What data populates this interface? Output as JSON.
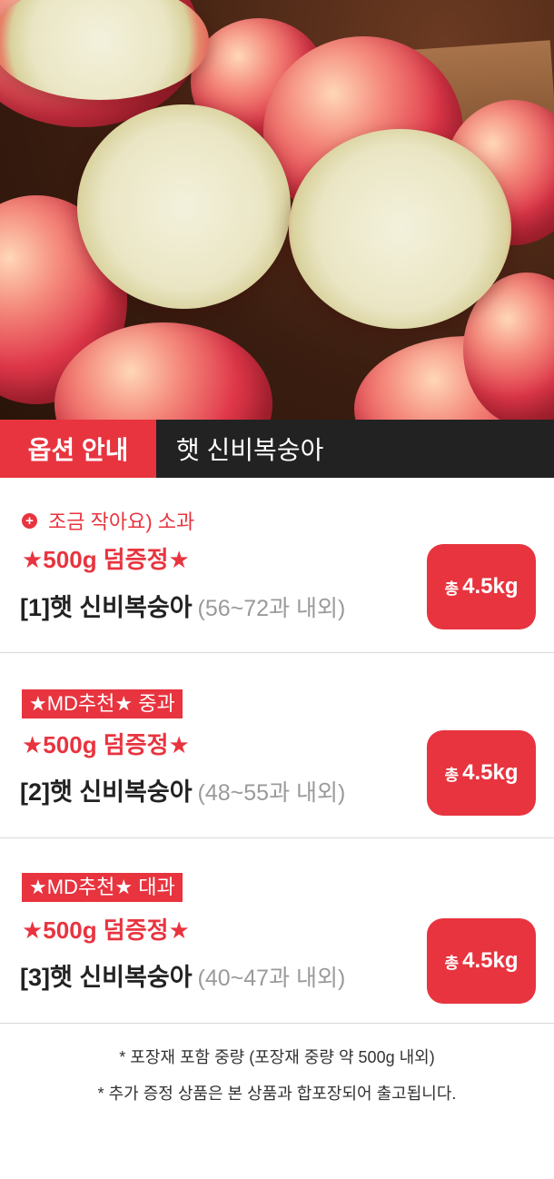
{
  "header": {
    "tag": "옵션 안내",
    "product": "햇 신비복숭아"
  },
  "options": [
    {
      "label": "조금 작아요) 소과",
      "gift": "★500g 덤증정★",
      "title": "[1]햇 신비복숭아",
      "range": "(56~72과 내외)",
      "weight_prefix": "총",
      "weight": "4.5kg"
    },
    {
      "label": "★MD추천★ 중과",
      "gift": "★500g 덤증정★",
      "title": "[2]햇 신비복숭아",
      "range": "(48~55과 내외)",
      "weight_prefix": "총",
      "weight": "4.5kg"
    },
    {
      "label": "★MD추천★ 대과",
      "gift": "★500g 덤증정★",
      "title": "[3]햇 신비복숭아",
      "range": "(40~47과 내외)",
      "weight_prefix": "총",
      "weight": "4.5kg"
    }
  ],
  "notes": [
    "* 포장재 포함 중량 (포장재 중량 약 500g 내외)",
    "* 추가 증정 상품은 본 상품과 합포장되어 출고됩니다."
  ],
  "colors": {
    "accent": "#e8343f",
    "dark": "#222222",
    "muted": "#9a9a9a"
  },
  "icons": {
    "plus": "plus-circle-icon"
  }
}
